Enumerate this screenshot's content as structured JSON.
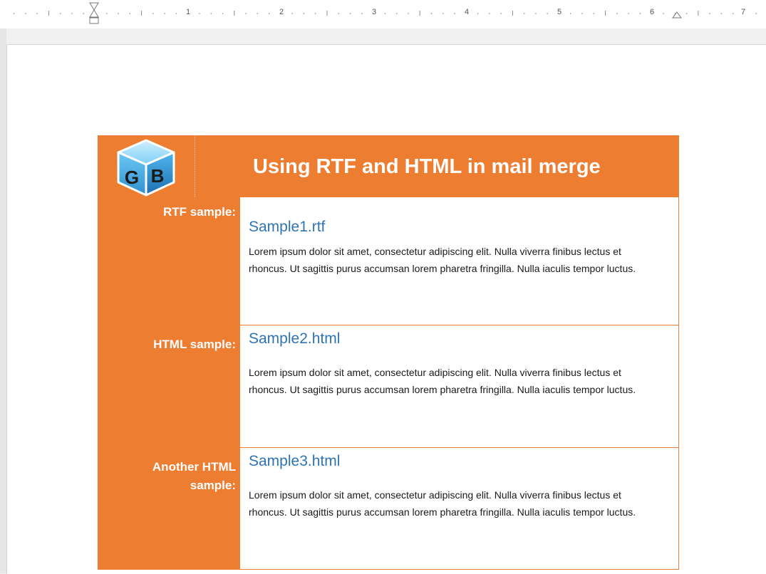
{
  "ruler": {
    "numbers": [
      "1",
      "2",
      "3",
      "4",
      "5",
      "6",
      "7"
    ]
  },
  "document": {
    "logo_text": "GB",
    "title": "Using RTF and HTML in mail merge",
    "rows": [
      {
        "label": "RTF sample:",
        "link": "Sample1.rtf",
        "text": "Lorem ipsum dolor sit amet, consectetur adipiscing elit. Nulla viverra finibus lectus et rhoncus. Ut sagittis purus accumsan lorem pharetra fringilla. Nulla iaculis tempor luctus."
      },
      {
        "label": "HTML sample:",
        "link": "Sample2.html",
        "text": "Lorem ipsum dolor sit amet, consectetur adipiscing elit. Nulla viverra finibus lectus et rhoncus. Ut sagittis purus accumsan lorem pharetra fringilla. Nulla iaculis tempor luctus."
      },
      {
        "label": "Another HTML sample:",
        "link": "Sample3.html",
        "text": "Lorem ipsum dolor sit amet, consectetur adipiscing elit. Nulla viverra finibus lectus et rhoncus. Ut sagittis purus accumsan lorem pharetra fringilla. Nulla iaculis tempor luctus."
      }
    ]
  },
  "colors": {
    "accent": "#ed7d31",
    "link": "#2e74b5"
  }
}
